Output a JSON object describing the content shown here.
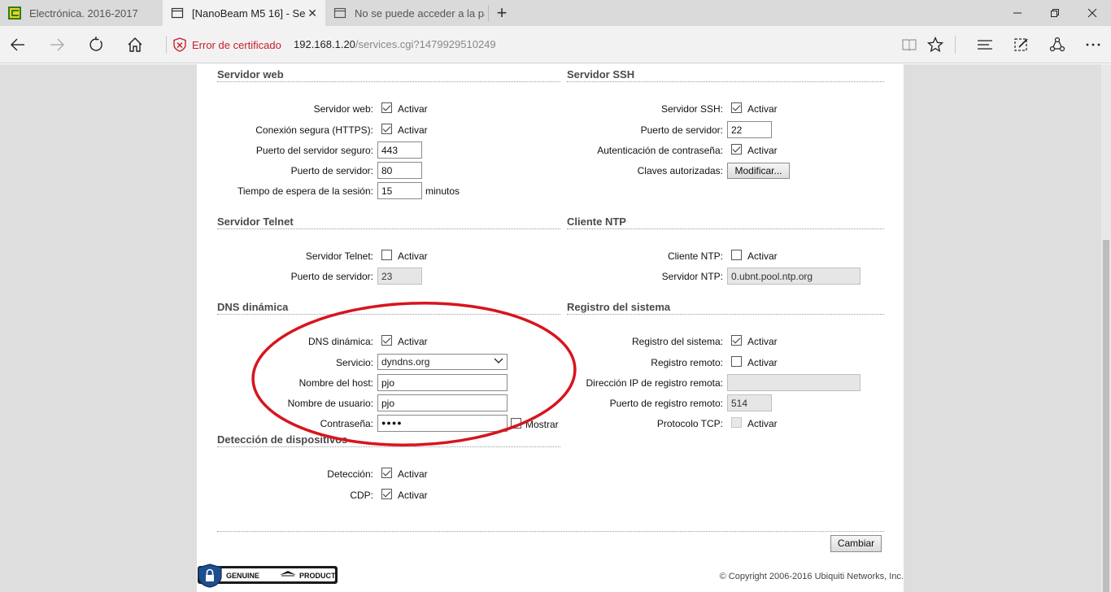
{
  "browser": {
    "tabs": [
      {
        "title": "Electrónica. 2016-2017"
      },
      {
        "title": "[NanoBeam M5 16] - Se"
      },
      {
        "title": "No se puede acceder a la pá"
      }
    ],
    "close_glyph": "✕",
    "new_tab_glyph": "+",
    "cert_error": "Error de certificado",
    "url_host": "192.168.1.20",
    "url_path": "/services.cgi?1479929510249",
    "icons": [
      "back-icon",
      "forward-icon",
      "refresh-icon",
      "home-icon",
      "shield-error-icon",
      "reading-view-icon",
      "favorite-star-icon",
      "hub-icon",
      "web-note-icon",
      "share-icon",
      "more-icon"
    ]
  },
  "page": {
    "sections": {
      "web": "Servidor web",
      "ssh": "Servidor SSH",
      "telnet": "Servidor Telnet",
      "ntp": "Cliente NTP",
      "ddns": "DNS dinámica",
      "syslog": "Registro del sistema",
      "discovery": "Detección de dispositivos"
    },
    "activate": "Activar",
    "web": {
      "web_server_label": "Servidor web:",
      "web_server_checked": true,
      "https_label": "Conexión segura (HTTPS):",
      "https_checked": true,
      "secure_port_label": "Puerto del servidor seguro:",
      "secure_port": "443",
      "port_label": "Puerto de servidor:",
      "port": "80",
      "timeout_label": "Tiempo de espera de la sesión:",
      "timeout": "15",
      "timeout_unit": "minutos"
    },
    "ssh": {
      "ssh_label": "Servidor SSH:",
      "ssh_checked": true,
      "port_label": "Puerto de servidor:",
      "port": "22",
      "pwauth_label": "Autenticación de contraseña:",
      "pwauth_checked": true,
      "keys_label": "Claves autorizadas:",
      "keys_button": "Modificar..."
    },
    "telnet": {
      "telnet_label": "Servidor Telnet:",
      "telnet_checked": false,
      "port_label": "Puerto de servidor:",
      "port": "23"
    },
    "ntp": {
      "ntp_label": "Cliente NTP:",
      "ntp_checked": false,
      "server_label": "Servidor NTP:",
      "server": "0.ubnt.pool.ntp.org"
    },
    "ddns": {
      "ddns_label": "DNS dinámica:",
      "ddns_checked": true,
      "service_label": "Servicio:",
      "service": "dyndns.org",
      "host_label": "Nombre del host:",
      "host": "pjo",
      "user_label": "Nombre de usuario:",
      "user": "pjo",
      "password_label": "Contraseña:",
      "password_mask": "●●●●",
      "show_label": "Mostrar",
      "show_checked": false
    },
    "syslog": {
      "syslog_label": "Registro del sistema:",
      "syslog_checked": true,
      "remote_label": "Registro remoto:",
      "remote_checked": false,
      "remote_ip_label": "Dirección IP de registro remota:",
      "remote_ip": "",
      "remote_port_label": "Puerto de registro remoto:",
      "remote_port": "514",
      "tcp_label": "Protocolo TCP:",
      "tcp_checked": false
    },
    "discovery": {
      "detect_label": "Detección:",
      "detect_checked": true,
      "cdp_label": "CDP:",
      "cdp_checked": true
    },
    "apply_button": "Cambiar",
    "genuine_left": "GENUINE",
    "genuine_right": "PRODUCT",
    "copyright": "© Copyright 2006-2016 Ubiquiti Networks, Inc.",
    "annotation_color": "#d8141e"
  }
}
